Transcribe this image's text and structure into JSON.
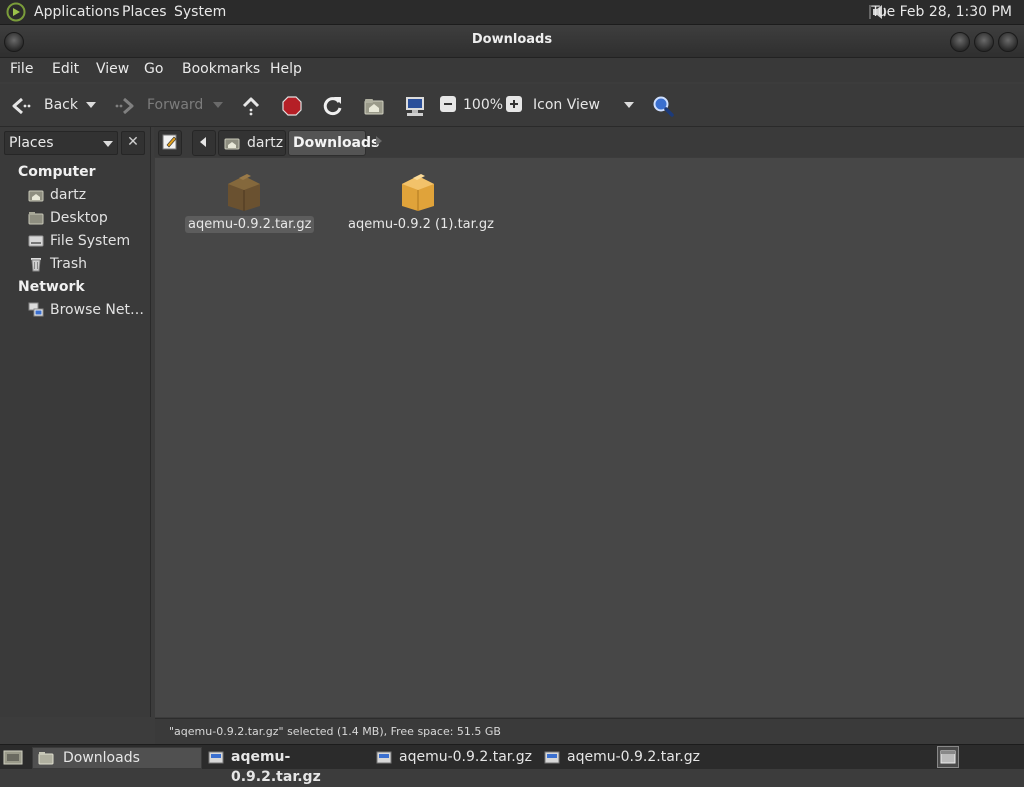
{
  "top_panel": {
    "menus": [
      "Applications",
      "Places",
      "System"
    ],
    "clock": "Tue Feb 28,  1:30 PM",
    "icons": {
      "menu_logo": "distro-logo-icon",
      "volume": "volume-icon"
    }
  },
  "window": {
    "title": "Downloads"
  },
  "menubar": [
    "File",
    "Edit",
    "View",
    "Go",
    "Bookmarks",
    "Help"
  ],
  "toolbar": {
    "back": "Back",
    "forward": "Forward",
    "zoom": "100%",
    "view_mode": "Icon View"
  },
  "sidebar": {
    "selector": "Places",
    "sections": [
      {
        "header": "Computer",
        "items": [
          "dartz",
          "Desktop",
          "File System",
          "Trash"
        ]
      },
      {
        "header": "Network",
        "items": [
          "Browse Net…"
        ]
      }
    ]
  },
  "pathbar": {
    "crumbs": [
      "dartz",
      "Downloads"
    ],
    "active": "Downloads"
  },
  "files": [
    {
      "name": "aqemu-0.9.2.tar.gz",
      "selected": true,
      "icon": "archive-package-icon"
    },
    {
      "name": "aqemu-0.9.2 (1).tar.gz",
      "selected": false,
      "icon": "archive-package-icon"
    }
  ],
  "statusbar": {
    "text": "\"aqemu-0.9.2.tar.gz\" selected (1.4 MB), Free space: 51.5 GB"
  },
  "taskbar": {
    "items": [
      "Downloads",
      "aqemu-0.9.2.tar.gz",
      "aqemu-0.9.2.tar.gz",
      "aqemu-0.9.2.tar.gz"
    ],
    "active_index": 1
  },
  "colors": {
    "panel": "#2b2b2b",
    "window": "#3a3a3a",
    "content": "#474747",
    "record": "#c0262d",
    "accent": "#3a7bd5"
  }
}
